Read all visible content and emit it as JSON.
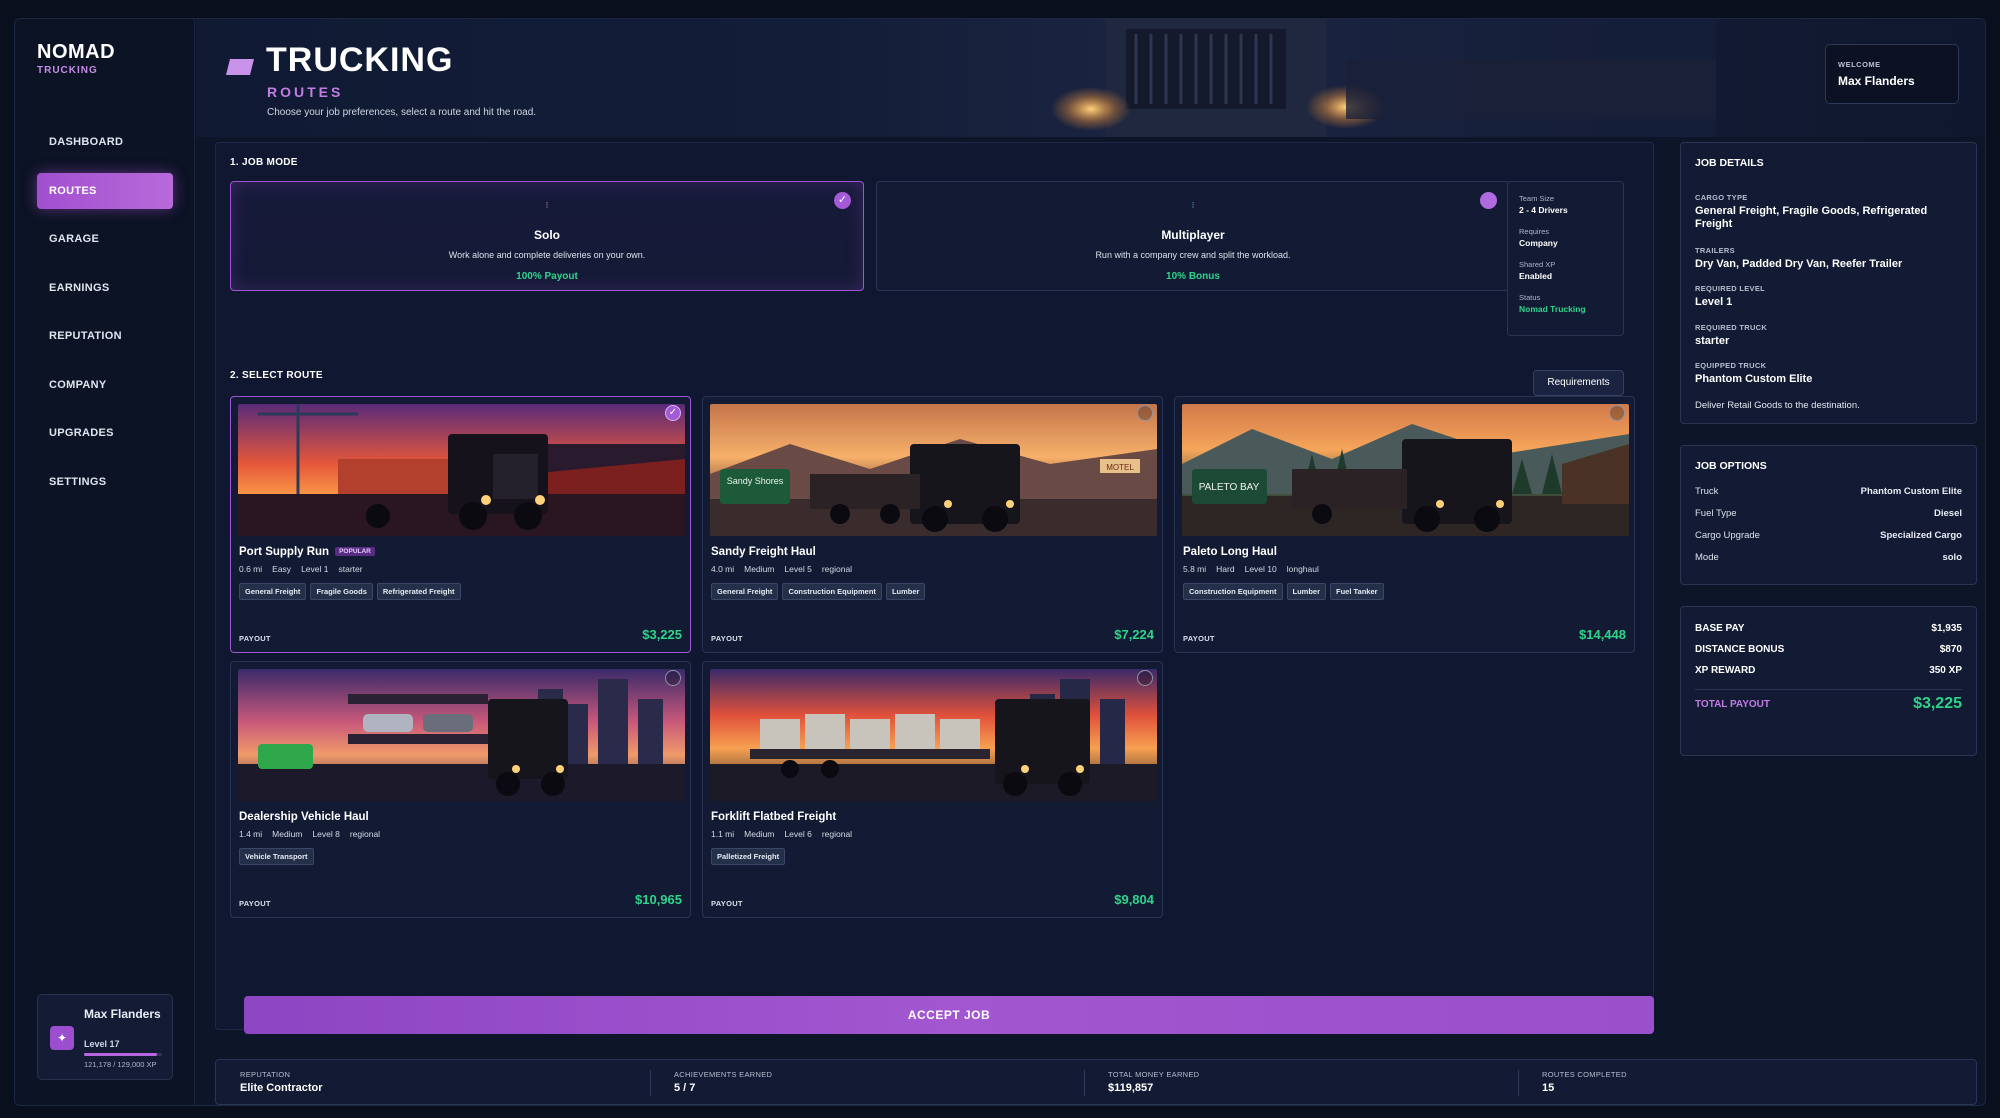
{
  "brand": {
    "name": "NOMAD",
    "sub": "TRUCKING"
  },
  "nav": [
    {
      "label": "DASHBOARD",
      "active": false
    },
    {
      "label": "ROUTES",
      "active": true
    },
    {
      "label": "GARAGE",
      "active": false
    },
    {
      "label": "EARNINGS",
      "active": false
    },
    {
      "label": "REPUTATION",
      "active": false
    },
    {
      "label": "COMPANY",
      "active": false
    },
    {
      "label": "UPGRADES",
      "active": false
    },
    {
      "label": "SETTINGS",
      "active": false
    }
  ],
  "profile": {
    "name": "Max Flanders",
    "level": "Level 17",
    "xp": "121,178 / 129,000 XP",
    "xp_fraction": 0.94
  },
  "header": {
    "title": "TRUCKING",
    "subtitle": "ROUTES",
    "description": "Choose your job preferences, select a route and hit the road.",
    "welcome_label": "WELCOME",
    "welcome_name": "Max Flanders"
  },
  "job_mode": {
    "title": "1. JOB MODE",
    "modes": [
      {
        "title": "Solo",
        "desc": "Work alone and complete deliveries on your own.",
        "bonus": "100% Payout",
        "selected": true
      },
      {
        "title": "Multiplayer",
        "desc": "Run with a company crew and split the workload.",
        "bonus": "10% Bonus",
        "selected": false
      }
    ],
    "team_info": [
      {
        "k": "Team Size",
        "v": "2 - 4 Drivers"
      },
      {
        "k": "Requires",
        "v": "Company"
      },
      {
        "k": "Shared XP",
        "v": "Enabled"
      },
      {
        "k": "Status",
        "v": "Nomad Trucking"
      }
    ]
  },
  "routes_section": {
    "title": "2. SELECT ROUTE",
    "requirements_label": "Requirements",
    "payout_label": "PAYOUT",
    "routes": [
      {
        "name": "Port Supply Run",
        "badge": "POPULAR",
        "distance": "0.6 mi",
        "difficulty": "Easy",
        "level": "Level 1",
        "truck": "starter",
        "tags": [
          "General Freight",
          "Fragile Goods",
          "Refrigerated Freight"
        ],
        "payout": "$3,225",
        "selected": true
      },
      {
        "name": "Sandy Freight Haul",
        "badge": "",
        "distance": "4.0 mi",
        "difficulty": "Medium",
        "level": "Level 5",
        "truck": "regional",
        "tags": [
          "General Freight",
          "Construction Equipment",
          "Lumber"
        ],
        "payout": "$7,224",
        "selected": false
      },
      {
        "name": "Paleto Long Haul",
        "badge": "",
        "distance": "5.8 mi",
        "difficulty": "Hard",
        "level": "Level 10",
        "truck": "longhaul",
        "tags": [
          "Construction Equipment",
          "Lumber",
          "Fuel Tanker"
        ],
        "payout": "$14,448",
        "selected": false
      },
      {
        "name": "Dealership Vehicle Haul",
        "badge": "",
        "distance": "1.4 mi",
        "difficulty": "Medium",
        "level": "Level 8",
        "truck": "regional",
        "tags": [
          "Vehicle Transport"
        ],
        "payout": "$10,965",
        "selected": false
      },
      {
        "name": "Forklift Flatbed Freight",
        "badge": "",
        "distance": "1.1 mi",
        "difficulty": "Medium",
        "level": "Level 6",
        "truck": "regional",
        "tags": [
          "Palletized Freight"
        ],
        "payout": "$9,804",
        "selected": false
      }
    ],
    "image_text": {
      "sandy": "Sandy Shores",
      "paleto": "PALETO BAY",
      "motel": "MOTEL"
    }
  },
  "accept_label": "ACCEPT JOB",
  "job_details": {
    "title": "JOB DETAILS",
    "rows": [
      {
        "k": "CARGO TYPE",
        "v": "General Freight, Fragile Goods, Refrigerated Freight"
      },
      {
        "k": "TRAILERS",
        "v": "Dry Van, Padded Dry Van, Reefer Trailer"
      },
      {
        "k": "REQUIRED LEVEL",
        "v": "Level 1"
      },
      {
        "k": "REQUIRED TRUCK",
        "v": "starter"
      },
      {
        "k": "EQUIPPED TRUCK",
        "v": "Phantom Custom Elite"
      }
    ],
    "note": "Deliver Retail Goods to the destination."
  },
  "job_options": {
    "title": "JOB OPTIONS",
    "rows": [
      {
        "k": "Truck",
        "v": "Phantom Custom Elite"
      },
      {
        "k": "Fuel Type",
        "v": "Diesel"
      },
      {
        "k": "Cargo Upgrade",
        "v": "Specialized Cargo"
      },
      {
        "k": "Mode",
        "v": "solo"
      }
    ]
  },
  "payout_summary": {
    "rows": [
      {
        "k": "BASE PAY",
        "v": "$1,935"
      },
      {
        "k": "DISTANCE BONUS",
        "v": "$870"
      },
      {
        "k": "XP REWARD",
        "v": "350 XP"
      }
    ],
    "total_label": "TOTAL PAYOUT",
    "total_value": "$3,225"
  },
  "stats": [
    {
      "k": "REPUTATION",
      "v": "Elite Contractor"
    },
    {
      "k": "ACHIEVEMENTS EARNED",
      "v": "5 / 7"
    },
    {
      "k": "TOTAL MONEY EARNED",
      "v": "$119,857"
    },
    {
      "k": "ROUTES COMPLETED",
      "v": "15"
    }
  ],
  "colors": {
    "accent": "#a35ad9",
    "money": "#2fd48a",
    "bg": "#0d1528"
  }
}
